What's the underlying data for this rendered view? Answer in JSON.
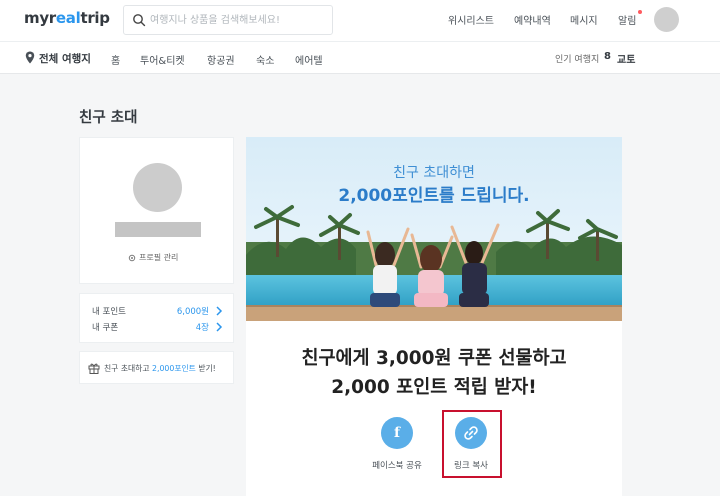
{
  "header": {
    "logo_main": "myr",
    "logo_accent": "eal",
    "logo_tail": "trip",
    "search_placeholder": "여행지나 상품을 검색해보세요!",
    "nav": [
      "위시리스트",
      "예약내역",
      "메시지",
      "알림"
    ]
  },
  "subnav": {
    "location_label": "전체 여행지",
    "items": [
      "홈",
      "투어&티켓",
      "항공권",
      "숙소",
      "에어텔"
    ],
    "popular_label": "인기 여행지",
    "popular_rank": "8",
    "popular_city": "교토"
  },
  "page": {
    "title": "친구 초대"
  },
  "profile": {
    "manage_label": "프로필 관리"
  },
  "points": {
    "rows": [
      {
        "label": "내 포인트",
        "value": "6,000원"
      },
      {
        "label": "내 쿠폰",
        "value": "4장"
      }
    ]
  },
  "invite_banner": {
    "text_before": "친구 초대하고 ",
    "text_highlight": "2,000포인트",
    "text_after": " 받기!"
  },
  "main": {
    "banner_line1": "친구 초대하면",
    "banner_line2": "2,000포인트를 드립니다.",
    "headline_line1": "친구에게 3,000원 쿠폰 선물하고",
    "headline_line2": "2,000 포인트 적립 받자!",
    "share": {
      "facebook_label": "페이스북 공유",
      "link_label": "링크 복사"
    }
  },
  "colors": {
    "accent": "#2b96ed",
    "highlight_border": "#c8102e"
  }
}
